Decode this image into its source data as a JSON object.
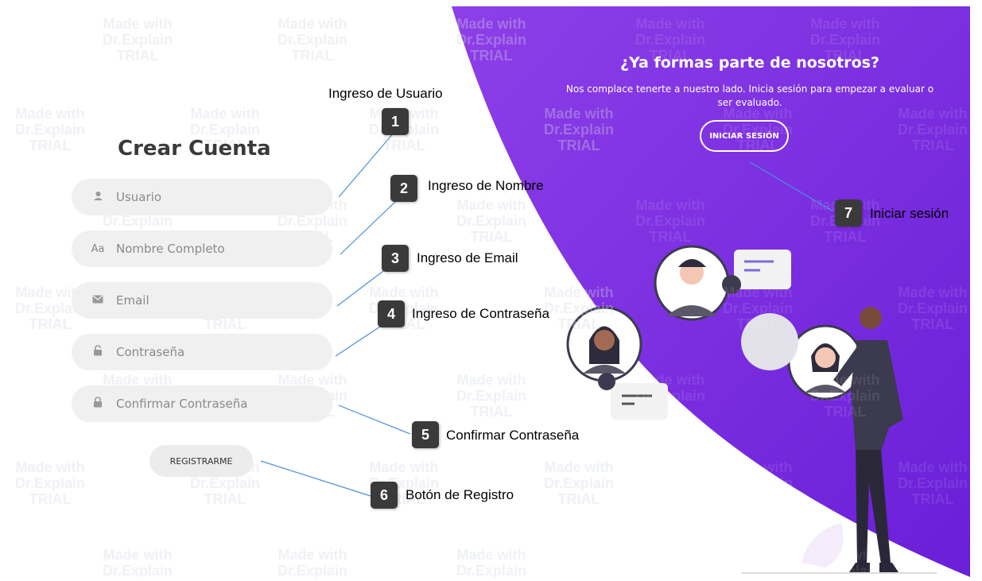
{
  "form": {
    "title": "Crear Cuenta",
    "fields": [
      {
        "icon": "user-icon",
        "placeholder": "Usuario"
      },
      {
        "icon": "text-icon",
        "icon_glyph": "Aa",
        "placeholder": "Nombre Completo"
      },
      {
        "icon": "envelope-icon",
        "placeholder": "Email"
      },
      {
        "icon": "lock-icon",
        "placeholder": "Contraseña"
      },
      {
        "icon": "lock-icon",
        "placeholder": "Confirmar Contraseña"
      }
    ],
    "register_label": "REGISTRARME"
  },
  "promo": {
    "title": "¿Ya formas parte de nosotros?",
    "body": "Nos complace tenerte a nuestro lado. Inicia sesión para empezar a evaluar o ser evaluado.",
    "login_label": "INICIAR SESIÓN"
  },
  "annotations": [
    {
      "number": "1",
      "label": "Ingreso de Usuario"
    },
    {
      "number": "2",
      "label": "Ingreso de Nombre"
    },
    {
      "number": "3",
      "label": "Ingreso de Email"
    },
    {
      "number": "4",
      "label": "Ingreso de Contraseña"
    },
    {
      "number": "5",
      "label": "Confirmar Contraseña"
    },
    {
      "number": "6",
      "label": "Botón de Registro"
    },
    {
      "number": "7",
      "label": "Iniciar sesión"
    }
  ],
  "watermark": [
    "Made with",
    "Dr.Explain",
    "TRIAL"
  ],
  "colors": {
    "purple": "#7e2fe0",
    "purple_light": "#a65df0",
    "field_bg": "#f0f0f0",
    "annotation_line": "#4a90d9",
    "badge_bg": "#3a3a3a"
  }
}
